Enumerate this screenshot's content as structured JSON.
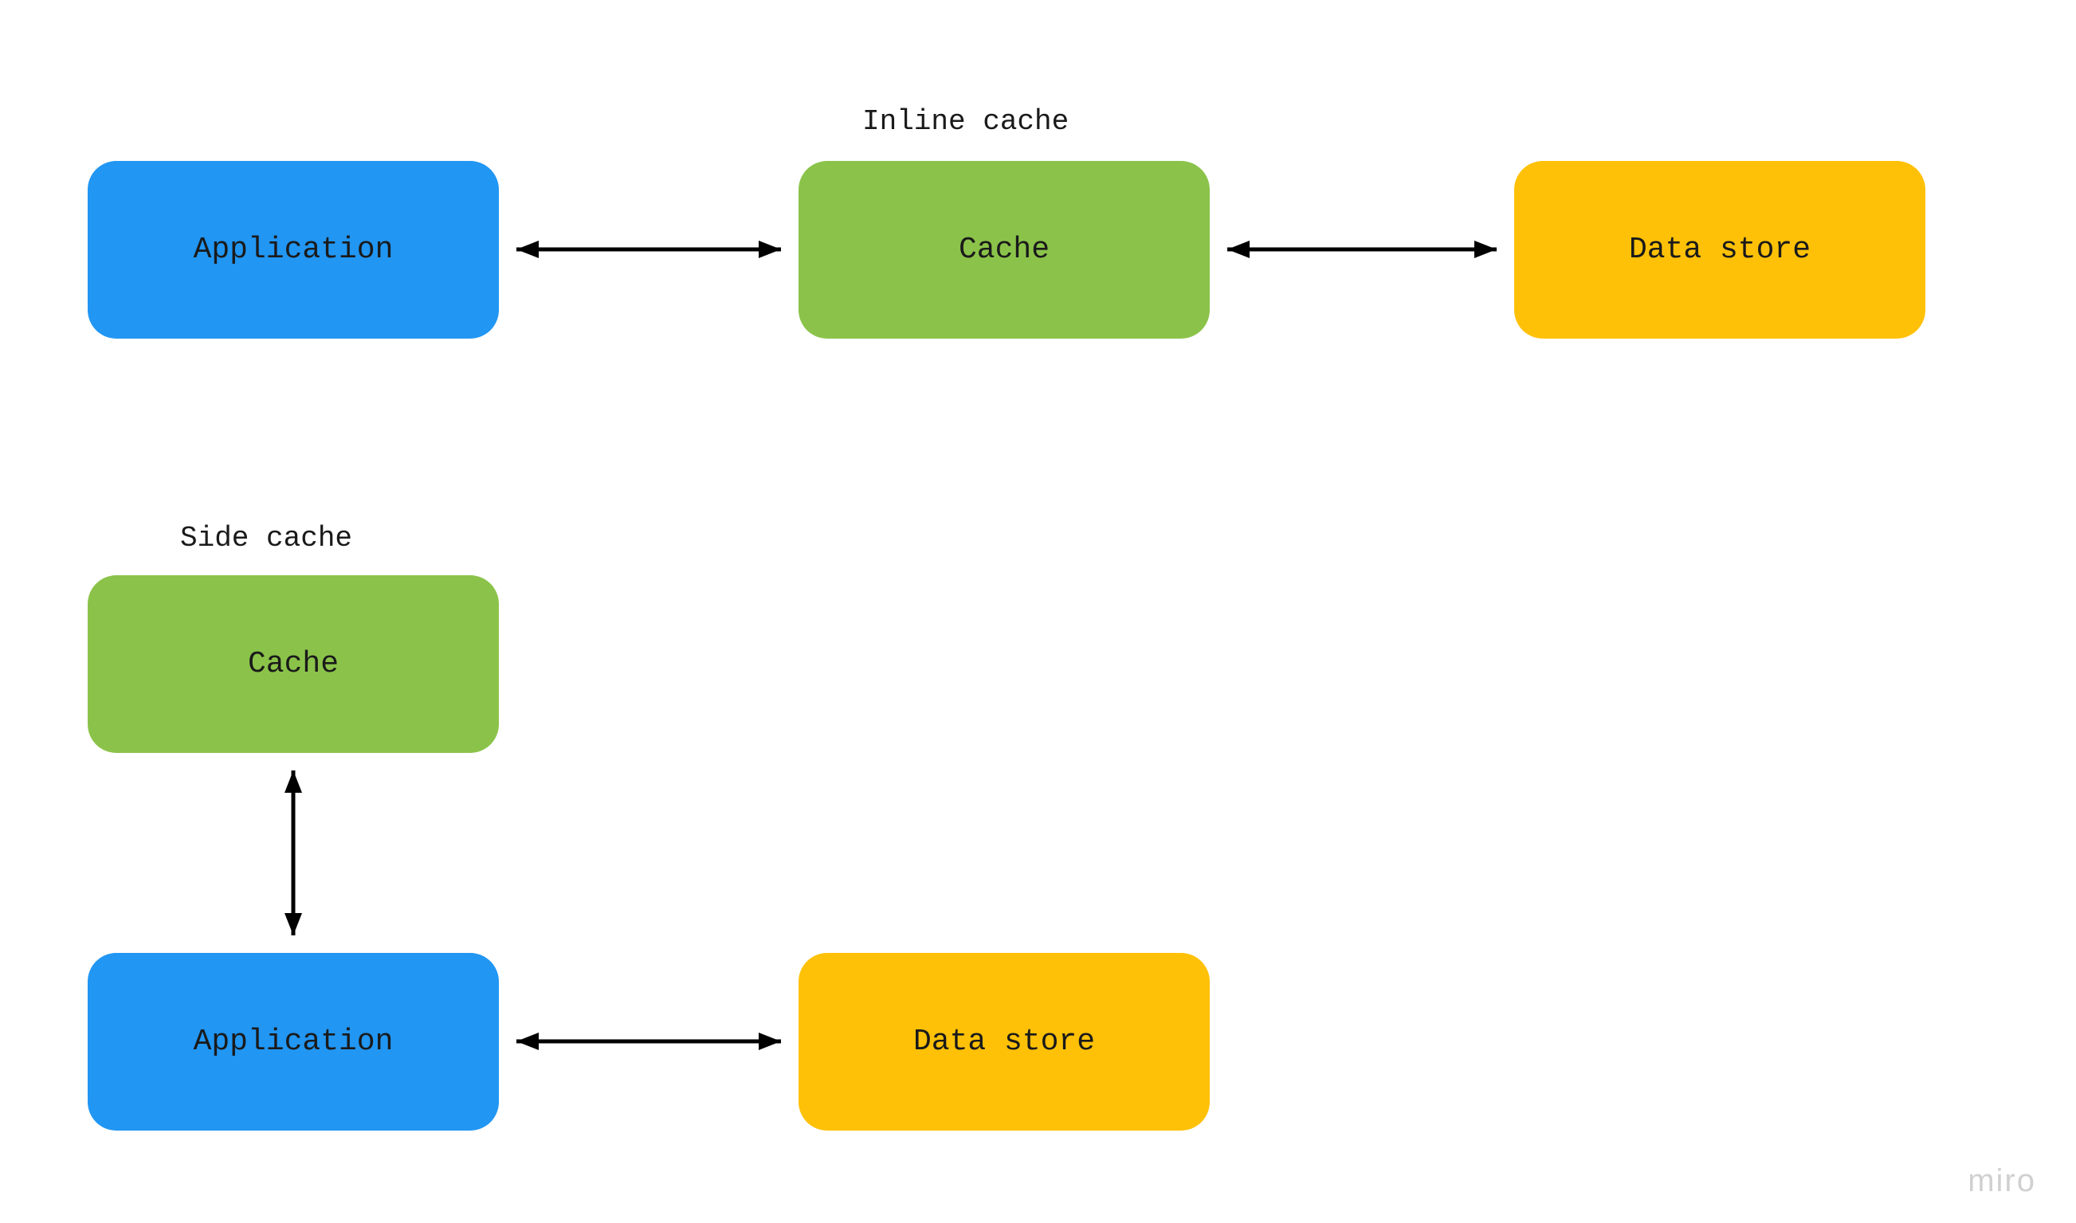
{
  "diagram": {
    "inline": {
      "title": "Inline cache",
      "application": "Application",
      "cache": "Cache",
      "datastore": "Data store"
    },
    "side": {
      "title": "Side cache",
      "cache": "Cache",
      "application": "Application",
      "datastore": "Data store"
    }
  },
  "watermark": "miro",
  "colors": {
    "application": "#2196f3",
    "cache": "#8BC34A",
    "datastore": "#FFC107"
  }
}
